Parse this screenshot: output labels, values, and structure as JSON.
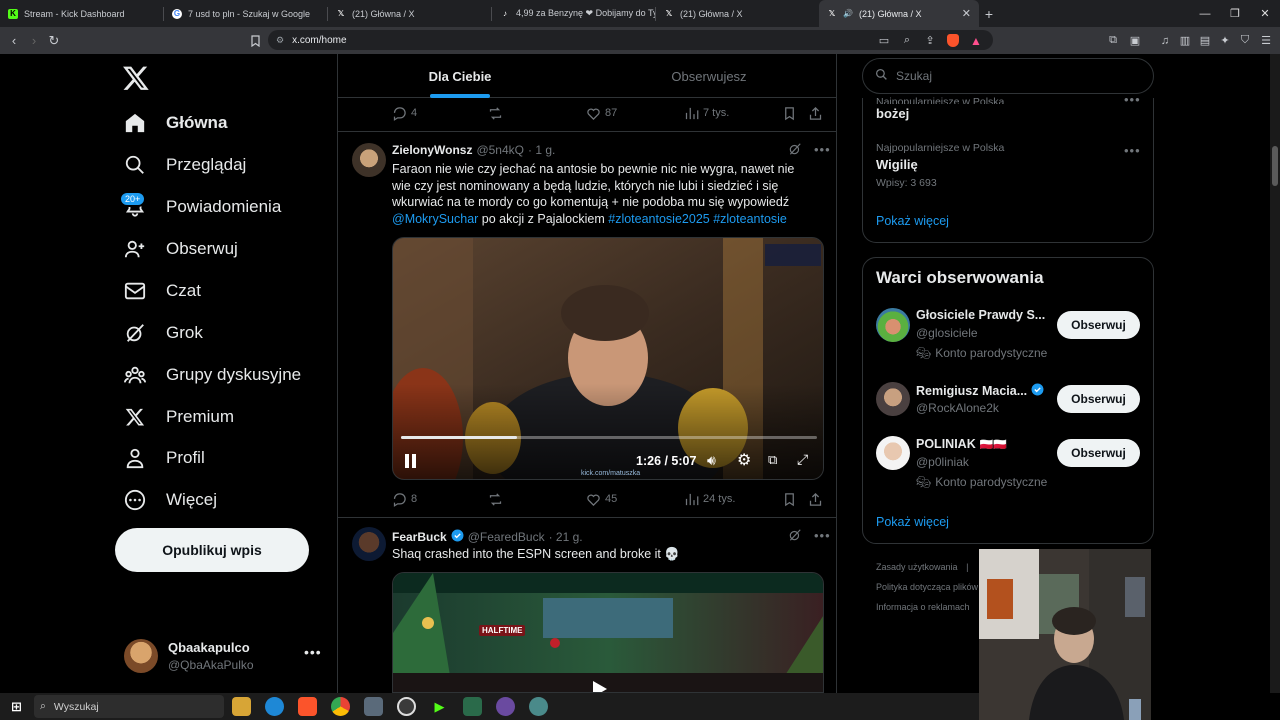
{
  "browser": {
    "tabs": [
      {
        "title": "Stream - Kick Dashboard",
        "fav": "K",
        "fav_color": "#53fc18"
      },
      {
        "title": "7 usd to pln - Szukaj w Google",
        "fav": "G",
        "fav_color": "#ffffff"
      },
      {
        "title": "(21) Główna / X",
        "fav": "X",
        "fav_color": "#000000"
      },
      {
        "title": "4,99 za Benzynę ❤ Dobijamy do Ty",
        "fav": "d",
        "fav_color": "#000000"
      },
      {
        "title": "(21) Główna / X",
        "fav": "X",
        "fav_color": "#000000"
      },
      {
        "title": "(21) Główna / X",
        "fav": "X",
        "fav_color": "#000000"
      }
    ],
    "url": "x.com/home"
  },
  "nav": {
    "items": [
      {
        "label": "Główna",
        "icon": "home-icon"
      },
      {
        "label": "Przeglądaj",
        "icon": "search-icon"
      },
      {
        "label": "Powiadomienia",
        "icon": "bell-icon"
      },
      {
        "label": "Obserwuj",
        "icon": "person-plus-icon"
      },
      {
        "label": "Czat",
        "icon": "mail-icon"
      },
      {
        "label": "Grok",
        "icon": "grok-icon"
      },
      {
        "label": "Grupy dyskusyjne",
        "icon": "community-icon"
      },
      {
        "label": "Premium",
        "icon": "x-logo-icon"
      },
      {
        "label": "Profil",
        "icon": "person-icon"
      },
      {
        "label": "Więcej",
        "icon": "more-circle-icon"
      }
    ],
    "notifications_badge": "20+",
    "post_button": "Opublikuj wpis",
    "profile": {
      "name": "Qbaakapulco",
      "handle": "@QbaAkaPulko"
    }
  },
  "feed": {
    "tabs": [
      "Dla Ciebie",
      "Obserwujesz"
    ],
    "prev_tweet_actions": {
      "replies": "4",
      "likes": "87",
      "views": "7 tys."
    },
    "tweet1": {
      "name": "ZielonyWonsz",
      "handle": "@5n4kQ",
      "time": "· 1 g.",
      "text_1": "Faraon nie wie czy jechać na antosie bo pewnie nic nie wygra, nawet nie wie czy jest nominowany a będą ludzie, których nie lubi i siedzieć i się wkurwiać na te mordy co go komentują + nie podoba mu się wypowiedź ",
      "mention": "@MokrySuchar",
      "text_2": " po akcji z Pajalockiem ",
      "hashtag_1": "#zloteantosie2025",
      "hashtag_2": " #zloteantosie",
      "video_time": "1:26 / 5:07",
      "video_progress": 0.28,
      "video_watermark": "kick.com/matuszka",
      "replies": "8",
      "likes": "45",
      "views": "24 tys."
    },
    "tweet2": {
      "name": "FearBuck",
      "handle": "@FearedBuck",
      "time": "· 21 g.",
      "text": "Shaq crashed into the ESPN screen and broke it 💀",
      "sign_text": "HALFTIME"
    }
  },
  "sidebar": {
    "search_placeholder": "Szukaj",
    "trends": [
      {
        "meta": "Najpopularniejsze w Polska",
        "name": "bożej",
        "count": ""
      },
      {
        "meta": "Najpopularniejsze w Polska",
        "name": "Wigilię",
        "count": "Wpisy: 3 693"
      }
    ],
    "show_more": "Pokaż więcej",
    "wtf_title": "Warci obserwowania",
    "who_to_follow": [
      {
        "name": "Głosiciele Prawdy S...",
        "handle": "@glosiciele",
        "label": "Konto parodystyczne",
        "verified": false,
        "flags": ""
      },
      {
        "name": "Remigiusz Macia...",
        "handle": "@RockAlone2k",
        "label": "",
        "verified": true,
        "flags": ""
      },
      {
        "name": "POLINIAK",
        "handle": "@p0liniak",
        "label": "Konto parodystyczne",
        "verified": false,
        "flags": "🇵🇱🇵🇱"
      }
    ],
    "follow_label": "Obserwuj",
    "show_more_2": "Pokaż więcej",
    "footer": [
      "Zasady użytkowania",
      "|",
      "Polityka dotycząca plików",
      "Informacja o reklamach"
    ]
  },
  "taskbar": {
    "search": "Wyszukaj"
  },
  "colors": {
    "accent": "#1d9bf0",
    "bg": "#000000",
    "border": "#2f3336",
    "muted": "#71767b"
  }
}
